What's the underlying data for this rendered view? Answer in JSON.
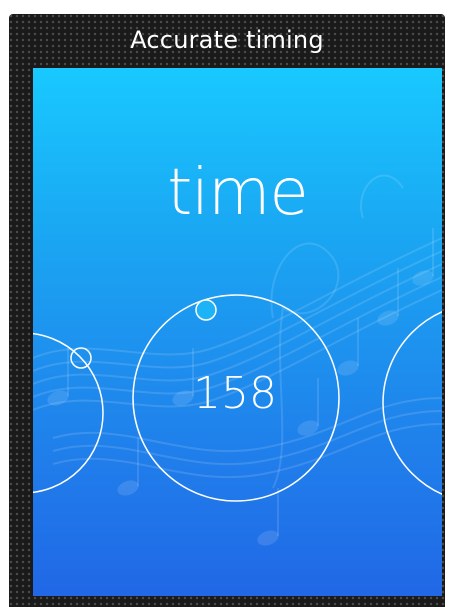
{
  "header": {
    "caption": "Accurate timing"
  },
  "screen": {
    "title": "time",
    "dial": {
      "value": "158"
    }
  },
  "colors": {
    "gradient_top": "#19c9ff",
    "gradient_bottom": "#2167e6",
    "frame_background": "#1a1a1a"
  },
  "icons": {
    "background": "music-notes-icon"
  }
}
